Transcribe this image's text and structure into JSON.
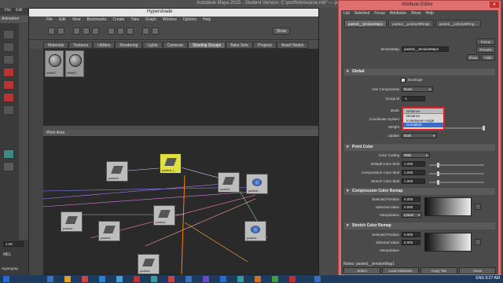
{
  "maya": {
    "title": "Autodesk Maya 2015 - Student Version: C:\\portfolio\\scene.mb* --- pasted__tensi...",
    "menu": [
      "File",
      "Edit"
    ],
    "anim_label": "Animation",
    "time_field": "1.00",
    "mel_label": "MEL",
    "bottom_label": "Hypergrap"
  },
  "hypershade": {
    "title": "Hypershade",
    "menu": [
      "File",
      "Edit",
      "View",
      "Bookmarks",
      "Create",
      "Tabs",
      "Graph",
      "Window",
      "Options",
      "Help"
    ],
    "show_label": "Show",
    "tabs": [
      "Materials",
      "Textures",
      "Utilities",
      "Rendering",
      "Lights",
      "Cameras",
      "Shading Groups",
      "Bake Sets",
      "Projects",
      "Asset Nodes"
    ],
    "active_tab": "Shading Groups",
    "swatches": [
      "initialP..",
      "initialS.."
    ],
    "work_area_label": "Work Area",
    "nodes": [
      "pasted..",
      "pasted_t..",
      "pasted..",
      "pasted..",
      "pasted..",
      "pasted..",
      "pasted..",
      "pasted..",
      "pasted.."
    ]
  },
  "attribute_editor": {
    "title": "Attribute Editor",
    "close": "✕",
    "menu": [
      "List",
      "Selected",
      "Focus",
      "Attributes",
      "Show",
      "Help"
    ],
    "tabs": [
      "pasted__tensionMap1",
      "pasted__polySplitRing6",
      "pasted__polySplitRing..."
    ],
    "focus_label": "Focus",
    "presets_label": "Presets",
    "show_label": "Show",
    "hide_label": "Hide",
    "node_label": "tensionMap:",
    "node_value": "pasted__tensionMap1",
    "global": {
      "header": "Global",
      "envelope": "Envelope",
      "use_components_label": "Use Components",
      "use_components_value": "None",
      "group_id_label": "Group Id",
      "group_id_value": "-1",
      "mode_label": "Mode",
      "mode_value": "Distance",
      "mode_options": [
        "Distance",
        "In-Between Angle",
        "Curvature"
      ],
      "mode_highlight": "Curvature",
      "coord_label": "Coordinate System",
      "weight_label": "Weight",
      "update_label": "Update",
      "update_value": "Both"
    },
    "point_color": {
      "header": "Point Color",
      "color_coding_label": "Color Coding",
      "color_coding_value": "RBB",
      "default_mult_label": "Default Color Mult",
      "default_mult_value": "1.000",
      "compression_mult_label": "Compression Color Mult",
      "compression_mult_value": "1.000",
      "stretch_mult_label": "Stretch Color Mult",
      "stretch_mult_value": "1.000"
    },
    "compression_remap": {
      "header": "Compression Color Remap",
      "sel_pos_label": "Selected Position",
      "sel_pos_value": "0.000",
      "sel_val_label": "Selected Value",
      "sel_val_value": "0.000",
      "interp_label": "Interpolation",
      "interp_value": "Linear"
    },
    "stretch_remap": {
      "header": "Stretch Color Remap",
      "sel_pos_label": "Selected Position",
      "sel_pos_value": "0.000",
      "sel_val_label": "Selected Value",
      "sel_val_value": "0.000",
      "interp_label": "Interpolation"
    },
    "notes": "Notes: pasted__tensionMap1",
    "buttons": [
      "Select",
      "Load Attributes",
      "Copy Tab",
      "Close"
    ]
  },
  "taskbar": {
    "lang": "ENG",
    "time": "8:27 AM"
  },
  "colors": {
    "highlight": "#e02020",
    "selected_node": "#e0e040",
    "taskbar": "#1e3a5c"
  }
}
